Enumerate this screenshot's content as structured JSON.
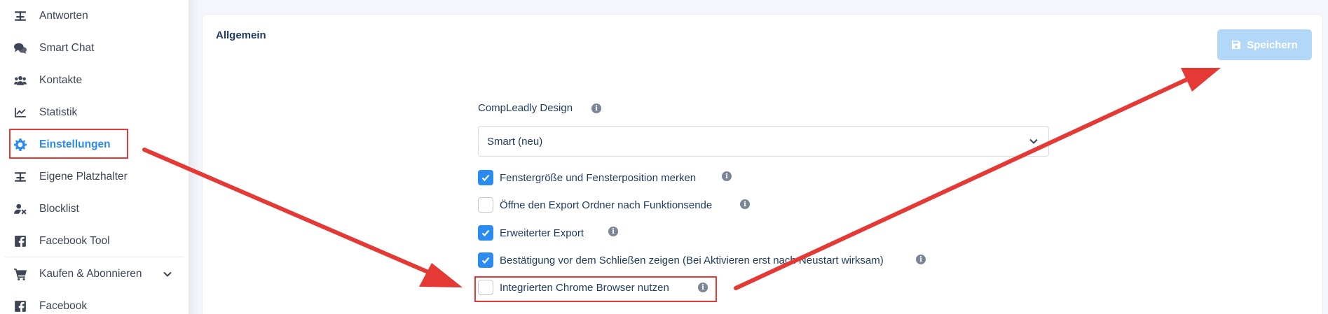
{
  "sidebar": {
    "items": [
      {
        "label": "Antworten",
        "icon": "placeholder-icon"
      },
      {
        "label": "Smart Chat",
        "icon": "chat-icon"
      },
      {
        "label": "Kontakte",
        "icon": "users-icon"
      },
      {
        "label": "Statistik",
        "icon": "chart-line-icon"
      },
      {
        "label": "Einstellungen",
        "icon": "gear-icon",
        "active": true
      },
      {
        "label": "Eigene Platzhalter",
        "icon": "placeholder-icon"
      },
      {
        "label": "Blocklist",
        "icon": "user-block-icon"
      },
      {
        "label": "Facebook Tool",
        "icon": "facebook-square-icon"
      },
      {
        "label": "Kaufen & Abonnieren",
        "icon": "cart-icon"
      },
      {
        "label": "Facebook",
        "icon": "facebook-square-icon"
      }
    ]
  },
  "main": {
    "title": "Allgemein",
    "save_label": "Speichern",
    "design_label": "CompLeadly Design",
    "design_value": "Smart (neu)",
    "checkboxes": [
      {
        "label": "Fenstergröße und Fensterposition merken",
        "checked": true
      },
      {
        "label": "Öffne den Export Ordner nach Funktionsende",
        "checked": false
      },
      {
        "label": "Erweiterter Export",
        "checked": true
      },
      {
        "label": "Bestätigung vor dem Schließen zeigen (Bei Aktivieren erst nach Neustart wirksam)",
        "checked": true
      },
      {
        "label": "Integrierten Chrome Browser nutzen",
        "checked": false
      }
    ]
  },
  "colors": {
    "accent": "#2a8cf0",
    "save_button_disabled": "#b3d8f7",
    "annotation": "#e53935",
    "text": "#1e3a5f"
  }
}
